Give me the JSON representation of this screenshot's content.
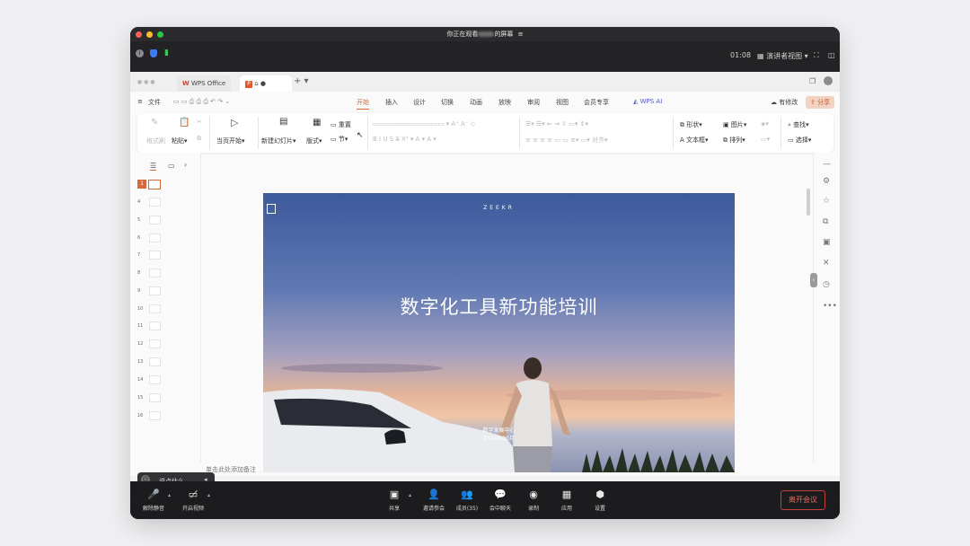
{
  "window": {
    "title_prefix": "你正在观看",
    "title_suffix": "的屏幕"
  },
  "meeting_top": {
    "time": "01:08",
    "presenter_view": "演讲者视图"
  },
  "tabs": [
    {
      "label": "WPS Office"
    },
    {
      "label": "P 产"
    }
  ],
  "menu": {
    "file": "文件",
    "items": [
      "开始",
      "插入",
      "设计",
      "切换",
      "动画",
      "放映",
      "审阅",
      "视图",
      "会员专享"
    ],
    "wps_ai": "WPS AI",
    "has_changes": "有修改",
    "share": "分享"
  },
  "ribbon": {
    "format_painter": "格式刷",
    "paste": "粘贴",
    "from_current": "当页开始",
    "new_slide": "新建幻灯片",
    "layout": "版式",
    "reset": "重置",
    "section": "节",
    "shape": "形状",
    "picture": "图片",
    "find": "查找",
    "textbox": "文本框",
    "arrange": "排列",
    "select": "选择"
  },
  "slide_numbers": [
    "1",
    "4",
    "5",
    "6",
    "7",
    "8",
    "9",
    "10",
    "11",
    "12",
    "13",
    "14",
    "15",
    "16"
  ],
  "slide": {
    "brand": "ZEEKR",
    "title": "数字化工具新功能培训",
    "dept": "数字发展中心",
    "date": "2024年10月"
  },
  "notes_placeholder": "单击此处添加备注",
  "chat_placeholder": "说点什么...",
  "bottom_bar": {
    "mute": "解除静音",
    "video": "开启视频",
    "share": "共享",
    "invite": "邀请参会",
    "members": "成员(35)",
    "chat": "会中聊天",
    "record": "录制",
    "apps": "应用",
    "settings": "设置",
    "leave": "离开会议"
  },
  "colors": {
    "accent": "#d5693a",
    "leave": "#c0423b"
  }
}
